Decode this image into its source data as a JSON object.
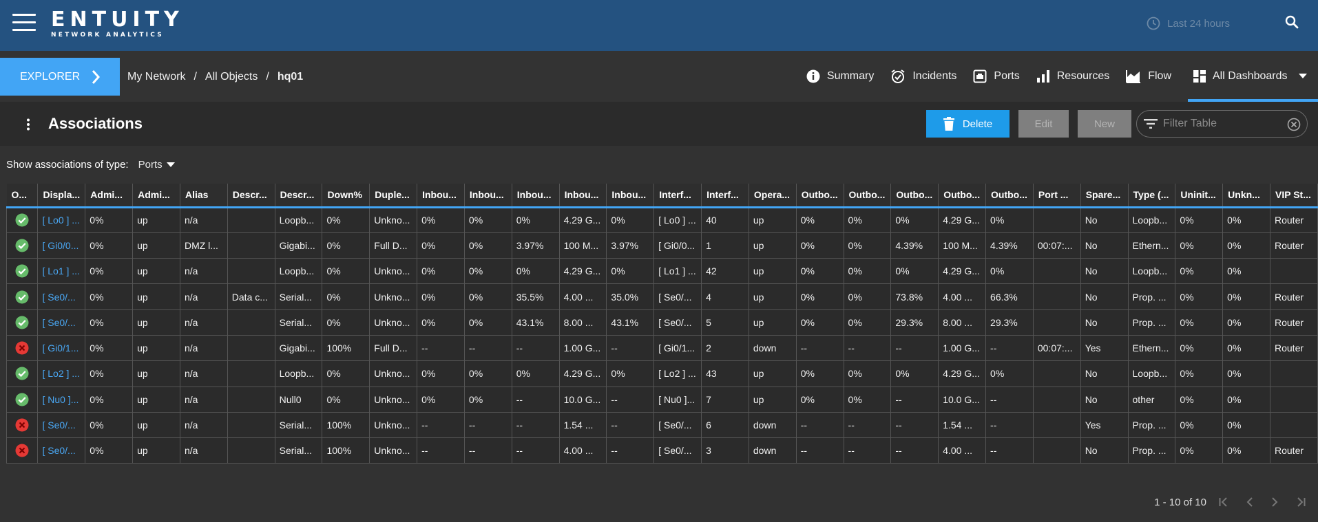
{
  "app": {
    "logo_main": "ENTUITY",
    "logo_sub": "NETWORK ANALYTICS",
    "time_range": "Last 24 hours"
  },
  "nav": {
    "explorer_label": "EXPLORER",
    "breadcrumb": [
      "My Network",
      "All Objects",
      "hq01"
    ],
    "breadcrumb_sep": "/",
    "tabs": [
      {
        "label": "Summary",
        "icon": "info-icon"
      },
      {
        "label": "Incidents",
        "icon": "alarm-clock-icon"
      },
      {
        "label": "Ports",
        "icon": "port-icon"
      },
      {
        "label": "Resources",
        "icon": "bar-chart-icon"
      },
      {
        "label": "Flow",
        "icon": "area-chart-icon"
      },
      {
        "label": "All Dashboards",
        "icon": "dashboard-icon"
      }
    ]
  },
  "panel": {
    "title": "Associations",
    "delete_label": "Delete",
    "edit_label": "Edit",
    "new_label": "New",
    "filter_placeholder": "Filter Table"
  },
  "assoc": {
    "label": "Show associations of type:",
    "selected": "Ports"
  },
  "table": {
    "headers": [
      "O...",
      "Displa...",
      "Admi...",
      "Admi...",
      "Alias",
      "Descr...",
      "Descr...",
      "Down%",
      "Duple...",
      "Inbou...",
      "Inbou...",
      "Inbou...",
      "Inbou...",
      "Inbou...",
      "Interf...",
      "Interf...",
      "Opera...",
      "Outbo...",
      "Outbo...",
      "Outbo...",
      "Outbo...",
      "Outbo...",
      "Port ...",
      "Spare...",
      "Type (...",
      "Uninit...",
      "Unkn...",
      "VIP St..."
    ],
    "rows": [
      {
        "status": "ok",
        "cells": [
          "[ Lo0 ] ...",
          "0%",
          "up",
          "n/a",
          "",
          "Loopb...",
          "0%",
          "Unkno...",
          "0%",
          "0%",
          "0%",
          "4.29 G...",
          "0%",
          "[ Lo0 ] ...",
          "40",
          "up",
          "0%",
          "0%",
          "0%",
          "4.29 G...",
          "0%",
          "",
          "No",
          "Loopb...",
          "0%",
          "0%",
          "Router"
        ]
      },
      {
        "status": "ok",
        "cells": [
          "[ Gi0/0...",
          "0%",
          "up",
          "DMZ l...",
          "",
          "Gigabi...",
          "0%",
          "Full D...",
          "0%",
          "0%",
          "3.97%",
          "100 M...",
          "3.97%",
          "[ Gi0/0...",
          "1",
          "up",
          "0%",
          "0%",
          "4.39%",
          "100 M...",
          "4.39%",
          "00:07:...",
          "No",
          "Ethern...",
          "0%",
          "0%",
          "Router"
        ]
      },
      {
        "status": "ok",
        "cells": [
          "[ Lo1 ] ...",
          "0%",
          "up",
          "n/a",
          "",
          "Loopb...",
          "0%",
          "Unkno...",
          "0%",
          "0%",
          "0%",
          "4.29 G...",
          "0%",
          "[ Lo1 ] ...",
          "42",
          "up",
          "0%",
          "0%",
          "0%",
          "4.29 G...",
          "0%",
          "",
          "No",
          "Loopb...",
          "0%",
          "0%",
          ""
        ]
      },
      {
        "status": "ok",
        "cells": [
          "[ Se0/...",
          "0%",
          "up",
          "n/a",
          "Data c...",
          "Serial...",
          "0%",
          "Unkno...",
          "0%",
          "0%",
          "35.5%",
          "4.00 ...",
          "35.0%",
          "[ Se0/...",
          "4",
          "up",
          "0%",
          "0%",
          "73.8%",
          "4.00 ...",
          "66.3%",
          "",
          "No",
          "Prop. ...",
          "0%",
          "0%",
          "Router"
        ]
      },
      {
        "status": "ok",
        "cells": [
          "[ Se0/...",
          "0%",
          "up",
          "n/a",
          "",
          "Serial...",
          "0%",
          "Unkno...",
          "0%",
          "0%",
          "43.1%",
          "8.00 ...",
          "43.1%",
          "[ Se0/...",
          "5",
          "up",
          "0%",
          "0%",
          "29.3%",
          "8.00 ...",
          "29.3%",
          "",
          "No",
          "Prop. ...",
          "0%",
          "0%",
          "Router"
        ]
      },
      {
        "status": "error",
        "cells": [
          "[ Gi0/1...",
          "0%",
          "up",
          "n/a",
          "",
          "Gigabi...",
          "100%",
          "Full D...",
          "--",
          "--",
          "--",
          "1.00 G...",
          "--",
          "[ Gi0/1...",
          "2",
          "down",
          "--",
          "--",
          "--",
          "1.00 G...",
          "--",
          "00:07:...",
          "Yes",
          "Ethern...",
          "0%",
          "0%",
          "Router"
        ]
      },
      {
        "status": "ok",
        "cells": [
          "[ Lo2 ] ...",
          "0%",
          "up",
          "n/a",
          "",
          "Loopb...",
          "0%",
          "Unkno...",
          "0%",
          "0%",
          "0%",
          "4.29 G...",
          "0%",
          "[ Lo2 ] ...",
          "43",
          "up",
          "0%",
          "0%",
          "0%",
          "4.29 G...",
          "0%",
          "",
          "No",
          "Loopb...",
          "0%",
          "0%",
          ""
        ]
      },
      {
        "status": "ok",
        "cells": [
          "[ Nu0 ]...",
          "0%",
          "up",
          "n/a",
          "",
          "Null0",
          "0%",
          "Unkno...",
          "0%",
          "0%",
          "--",
          "10.0 G...",
          "--",
          "[ Nu0 ]...",
          "7",
          "up",
          "0%",
          "0%",
          "--",
          "10.0 G...",
          "--",
          "",
          "No",
          "other",
          "0%",
          "0%",
          ""
        ]
      },
      {
        "status": "error",
        "cells": [
          "[ Se0/...",
          "0%",
          "up",
          "n/a",
          "",
          "Serial...",
          "100%",
          "Unkno...",
          "--",
          "--",
          "--",
          "1.54 ...",
          "--",
          "[ Se0/...",
          "6",
          "down",
          "--",
          "--",
          "--",
          "1.54 ...",
          "--",
          "",
          "Yes",
          "Prop. ...",
          "0%",
          "0%",
          ""
        ]
      },
      {
        "status": "error",
        "cells": [
          "[ Se0/...",
          "0%",
          "up",
          "n/a",
          "",
          "Serial...",
          "100%",
          "Unkno...",
          "--",
          "--",
          "--",
          "4.00 ...",
          "--",
          "[ Se0/...",
          "3",
          "down",
          "--",
          "--",
          "--",
          "4.00 ...",
          "--",
          "",
          "No",
          "Prop. ...",
          "0%",
          "0%",
          "Router"
        ]
      }
    ]
  },
  "pagination": {
    "text": "1 - 10 of 10"
  },
  "colors": {
    "topbar": "#245280",
    "accent": "#42a5f5",
    "ok": "#66bb6a",
    "error": "#e53935"
  }
}
